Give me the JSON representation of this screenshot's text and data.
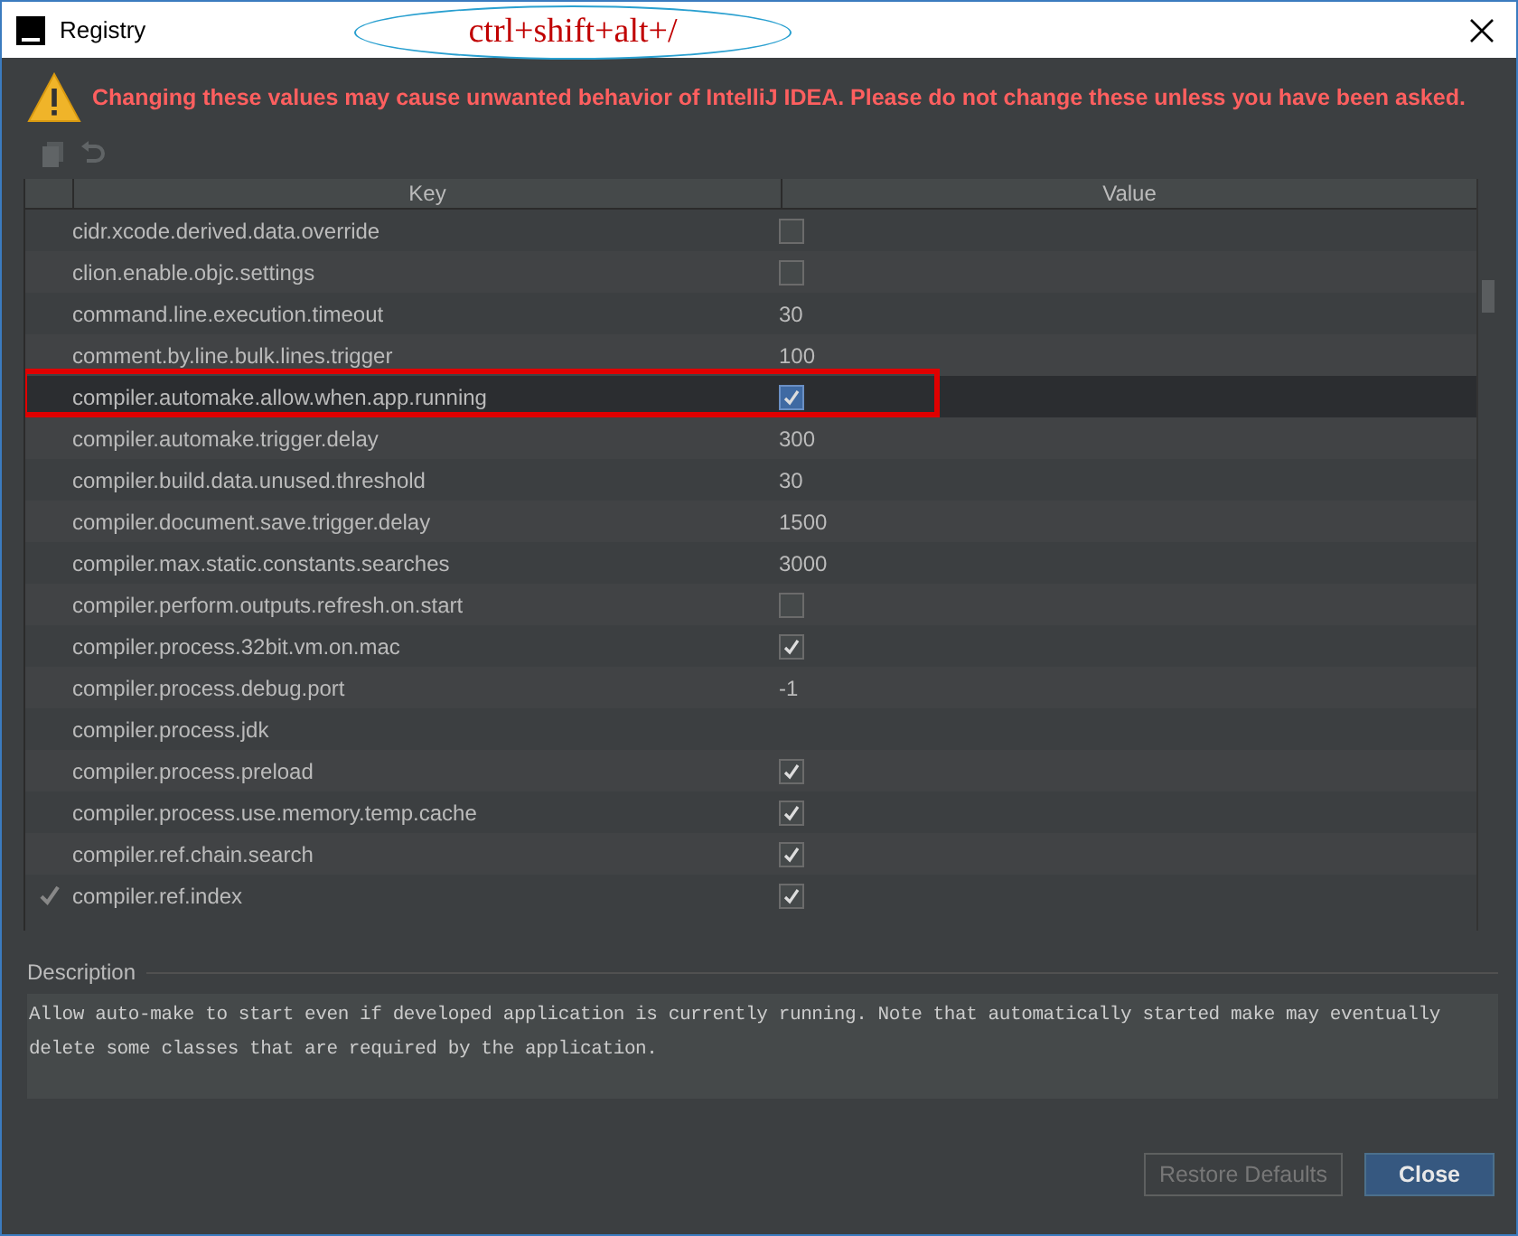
{
  "window": {
    "title": "Registry",
    "annotation": "ctrl+shift+alt+/"
  },
  "warning": "Changing these values may cause unwanted behavior of IntelliJ IDEA. Please do not change these unless you have been asked.",
  "table": {
    "columns": [
      "Key",
      "Value"
    ],
    "rows": [
      {
        "key": "cidr.xcode.derived.data.override",
        "kind": "checkbox",
        "checked": false,
        "selected": false,
        "highlighted": false,
        "modified": false
      },
      {
        "key": "clion.enable.objc.settings",
        "kind": "checkbox",
        "checked": false,
        "selected": false,
        "highlighted": false,
        "modified": false
      },
      {
        "key": "command.line.execution.timeout",
        "kind": "text",
        "value": "30",
        "selected": false,
        "highlighted": false,
        "modified": false
      },
      {
        "key": "comment.by.line.bulk.lines.trigger",
        "kind": "text",
        "value": "100",
        "selected": false,
        "highlighted": false,
        "modified": false
      },
      {
        "key": "compiler.automake.allow.when.app.running",
        "kind": "checkbox",
        "checked": true,
        "selected": true,
        "highlighted": true,
        "modified": false
      },
      {
        "key": "compiler.automake.trigger.delay",
        "kind": "text",
        "value": "300",
        "selected": false,
        "highlighted": false,
        "modified": false
      },
      {
        "key": "compiler.build.data.unused.threshold",
        "kind": "text",
        "value": "30",
        "selected": false,
        "highlighted": false,
        "modified": false
      },
      {
        "key": "compiler.document.save.trigger.delay",
        "kind": "text",
        "value": "1500",
        "selected": false,
        "highlighted": false,
        "modified": false
      },
      {
        "key": "compiler.max.static.constants.searches",
        "kind": "text",
        "value": "3000",
        "selected": false,
        "highlighted": false,
        "modified": false
      },
      {
        "key": "compiler.perform.outputs.refresh.on.start",
        "kind": "checkbox",
        "checked": false,
        "selected": false,
        "highlighted": false,
        "modified": false
      },
      {
        "key": "compiler.process.32bit.vm.on.mac",
        "kind": "checkbox",
        "checked": true,
        "selected": false,
        "highlighted": false,
        "modified": false
      },
      {
        "key": "compiler.process.debug.port",
        "kind": "text",
        "value": "-1",
        "selected": false,
        "highlighted": false,
        "modified": false
      },
      {
        "key": "compiler.process.jdk",
        "kind": "text",
        "selected": false,
        "highlighted": false,
        "modified": false
      },
      {
        "key": "compiler.process.preload",
        "kind": "checkbox",
        "checked": true,
        "selected": false,
        "highlighted": false,
        "modified": false
      },
      {
        "key": "compiler.process.use.memory.temp.cache",
        "kind": "checkbox",
        "checked": true,
        "selected": false,
        "highlighted": false,
        "modified": false
      },
      {
        "key": "compiler.ref.chain.search",
        "kind": "checkbox",
        "checked": true,
        "selected": false,
        "highlighted": false,
        "modified": false
      },
      {
        "key": "compiler.ref.index",
        "kind": "checkbox",
        "checked": true,
        "selected": false,
        "highlighted": false,
        "modified": true
      }
    ]
  },
  "description": {
    "label": "Description",
    "text": "Allow auto-make to start even if developed application is currently running. Note that automatically started make may eventually delete some classes that are required by the application."
  },
  "buttons": [
    {
      "label": "Restore Defaults",
      "kind": "secondary"
    },
    {
      "label": "Close",
      "kind": "primary"
    }
  ]
}
